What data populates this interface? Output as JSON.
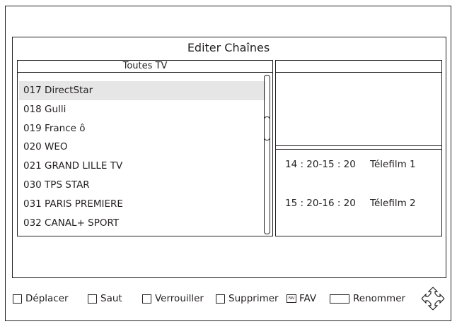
{
  "screen": {
    "title": "Editer Chaînes"
  },
  "channel_list": {
    "header": "Toutes TV",
    "items": [
      {
        "label": "017 DirectStar",
        "selected": true
      },
      {
        "label": "018 Gulli",
        "selected": false
      },
      {
        "label": "019 France ô",
        "selected": false
      },
      {
        "label": "020 WEO",
        "selected": false
      },
      {
        "label": "021 GRAND LILLE TV",
        "selected": false
      },
      {
        "label": "030 TPS STAR",
        "selected": false
      },
      {
        "label": "031 PARIS PREMIERE",
        "selected": false
      },
      {
        "label": "032 CANAL+ SPORT",
        "selected": false
      }
    ]
  },
  "epg": [
    {
      "time": "14 : 20-15 : 20",
      "program": "Télefilm 1"
    },
    {
      "time": "15 : 20-16 : 20",
      "program": "Télefilm 2"
    }
  ],
  "legend": {
    "move": "Déplacer",
    "skip": "Saut",
    "lock": "Verrouiller",
    "delete": "Supprimer",
    "fav_icon_text": "FAV",
    "fav": "FAV",
    "rename": "Renommer"
  },
  "icons": {
    "navigation": "dpad-arrows-icon"
  },
  "colors": {
    "line": "#231f20",
    "selected_row": "#e6e6e6",
    "background": "#ffffff"
  }
}
